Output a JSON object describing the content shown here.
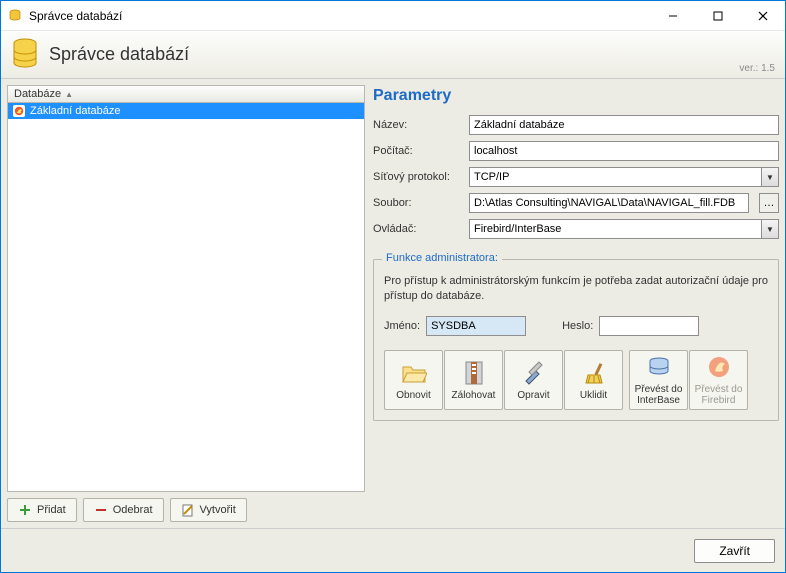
{
  "titlebar": {
    "title": "Správce databází"
  },
  "banner": {
    "title": "Správce databází",
    "version": "ver.: 1.5"
  },
  "database_list": {
    "header": "Databáze",
    "items": [
      {
        "label": "Základní databáze",
        "selected": true
      }
    ]
  },
  "left_buttons": {
    "add": "Přidat",
    "remove": "Odebrat",
    "create": "Vytvořit"
  },
  "parameters": {
    "title": "Parametry",
    "labels": {
      "name": "Název:",
      "host": "Počítač:",
      "protocol": "Síťový protokol:",
      "file": "Soubor:",
      "driver": "Ovládač:"
    },
    "values": {
      "name": "Základní databáze",
      "host": "localhost",
      "protocol": "TCP/IP",
      "file": "D:\\Atlas Consulting\\NAVIGAL\\Data\\NAVIGAL_fill.FDB",
      "driver": "Firebird/InterBase"
    }
  },
  "admin": {
    "legend": "Funkce administratora:",
    "desc": "Pro přístup k administrátorským funkcím je potřeba zadat autorizační údaje pro přístup do databáze.",
    "labels": {
      "username": "Jméno:",
      "password": "Heslo:"
    },
    "values": {
      "username": "SYSDBA",
      "password": ""
    },
    "actions": {
      "restore": "Obnovit",
      "backup": "Zálohovat",
      "repair": "Opravit",
      "cleanup": "Uklidit",
      "to_interbase": "Převést do InterBase",
      "to_firebird": "Převést do Firebird"
    }
  },
  "footer": {
    "close": "Zavřít"
  }
}
